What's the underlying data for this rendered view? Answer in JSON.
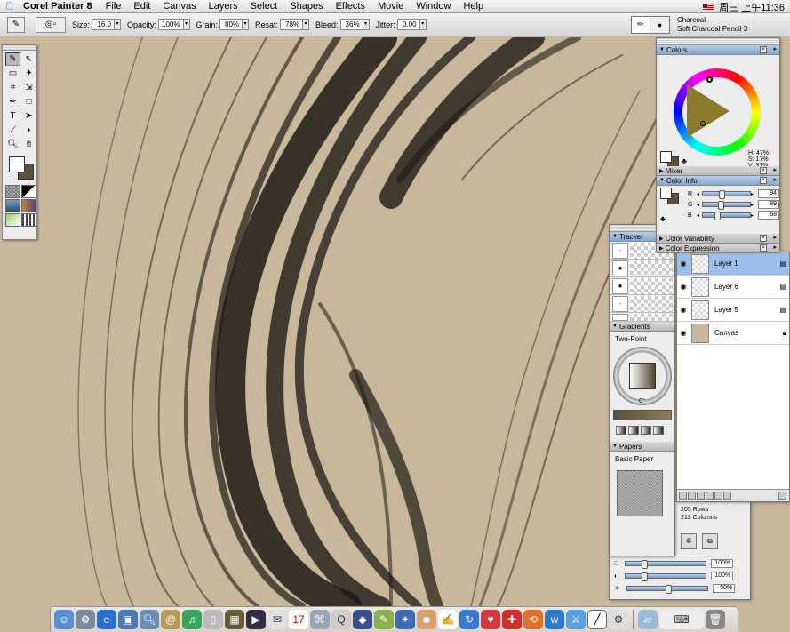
{
  "menubar": {
    "app_name": "Corel Painter 8",
    "items": [
      "File",
      "Edit",
      "Canvas",
      "Layers",
      "Select",
      "Shapes",
      "Effects",
      "Movie",
      "Window",
      "Help"
    ],
    "clock": "周三 上午11:36"
  },
  "propbar": {
    "size_label": "Size:",
    "size_value": "16.0",
    "opacity_label": "Opacity:",
    "opacity_value": "100%",
    "grain_label": "Grain:",
    "grain_value": "80%",
    "resat_label": "Resat:",
    "resat_value": "78%",
    "bleed_label": "Bleed:",
    "bleed_value": "36%",
    "jitter_label": "Jitter:",
    "jitter_value": "0.00",
    "brush_category": "Charcoal",
    "brush_variant": "Soft Charcoal Pencil 3"
  },
  "colors_palette": {
    "title": "Colors",
    "h": "H: 47%",
    "s": "S: 17%",
    "v": "V: 31%",
    "main_color": "#ffffff",
    "additional_color": "#5a5040"
  },
  "mixer": {
    "title": "Mixer"
  },
  "color_info": {
    "title": "Color Info",
    "r_label": "R",
    "r_value": "94",
    "g_label": "G",
    "g_value": "89",
    "b_label": "B",
    "b_value": "68"
  },
  "color_variability": {
    "title": "Color Variability"
  },
  "color_expression": {
    "title": "Color Expression"
  },
  "tracker": {
    "title": "Tracker"
  },
  "gradients": {
    "title": "Gradients",
    "selected": "Two-Point",
    "angle": "0°"
  },
  "papers": {
    "title": "Papers",
    "selected": "Basic Paper",
    "rows": "205 Rows",
    "columns": "213 Columns",
    "scale": "100%",
    "contrast": "100%",
    "brightness": "50%"
  },
  "layers": {
    "items": [
      {
        "name": "Layer 1",
        "selected": true
      },
      {
        "name": "Layer 6",
        "selected": false
      },
      {
        "name": "Layer 5",
        "selected": false
      },
      {
        "name": "Canvas",
        "selected": false
      }
    ]
  },
  "canvas": {
    "background_color": "#c8b79a"
  },
  "dock": {
    "icons": [
      "finder-icon",
      "system-preferences-icon",
      "ie-icon",
      "preview-icon",
      "sherlock-icon",
      "address-book-icon",
      "itunes-icon",
      "trash-like-icon",
      "iphoto-icon",
      "imovie-icon",
      "mail-icon",
      "ical-icon",
      "appleworks-icon",
      "quicktime-icon",
      "keynote-icon",
      "painter-icon",
      "brush-icon",
      "globe-icon",
      "heart-icon",
      "cross-icon",
      "swirl-icon",
      "arrows-icon",
      "w-icon",
      "sword-icon",
      "pen-icon",
      "gear-icon",
      "folder-icon",
      "keyboard-icon",
      "trash-icon"
    ]
  }
}
